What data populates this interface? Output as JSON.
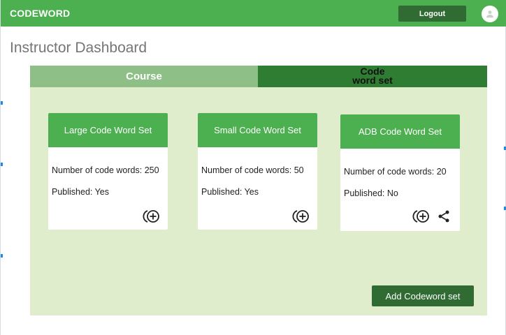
{
  "app": {
    "brand": "CODEWORD"
  },
  "header": {
    "logout_label": "Logout",
    "avatar_icon": "person-icon"
  },
  "page": {
    "title": "Instructor Dashboard"
  },
  "tabs": [
    {
      "label": "Course"
    },
    {
      "label": "Code word set"
    }
  ],
  "cards": [
    {
      "title": "Large Code Word Set",
      "count_text": "Number of code words: 250",
      "published_text": "Published: Yes",
      "actions": [
        "add-icon"
      ]
    },
    {
      "title": "Small Code Word Set",
      "count_text": "Number of code words: 50",
      "published_text": "Published: Yes",
      "actions": [
        "add-icon"
      ]
    },
    {
      "title": "ADB Code Word Set",
      "count_text": "Number of code words: 20",
      "published_text": "Published: No",
      "actions": [
        "add-icon",
        "share-icon"
      ]
    }
  ],
  "footer": {
    "add_set_label": "Add Codeword set"
  },
  "colors": {
    "primary": "#4caf50",
    "dark": "#2f6b32",
    "panel_bg": "#dfedcc",
    "tab_active": "#8dbf87"
  }
}
